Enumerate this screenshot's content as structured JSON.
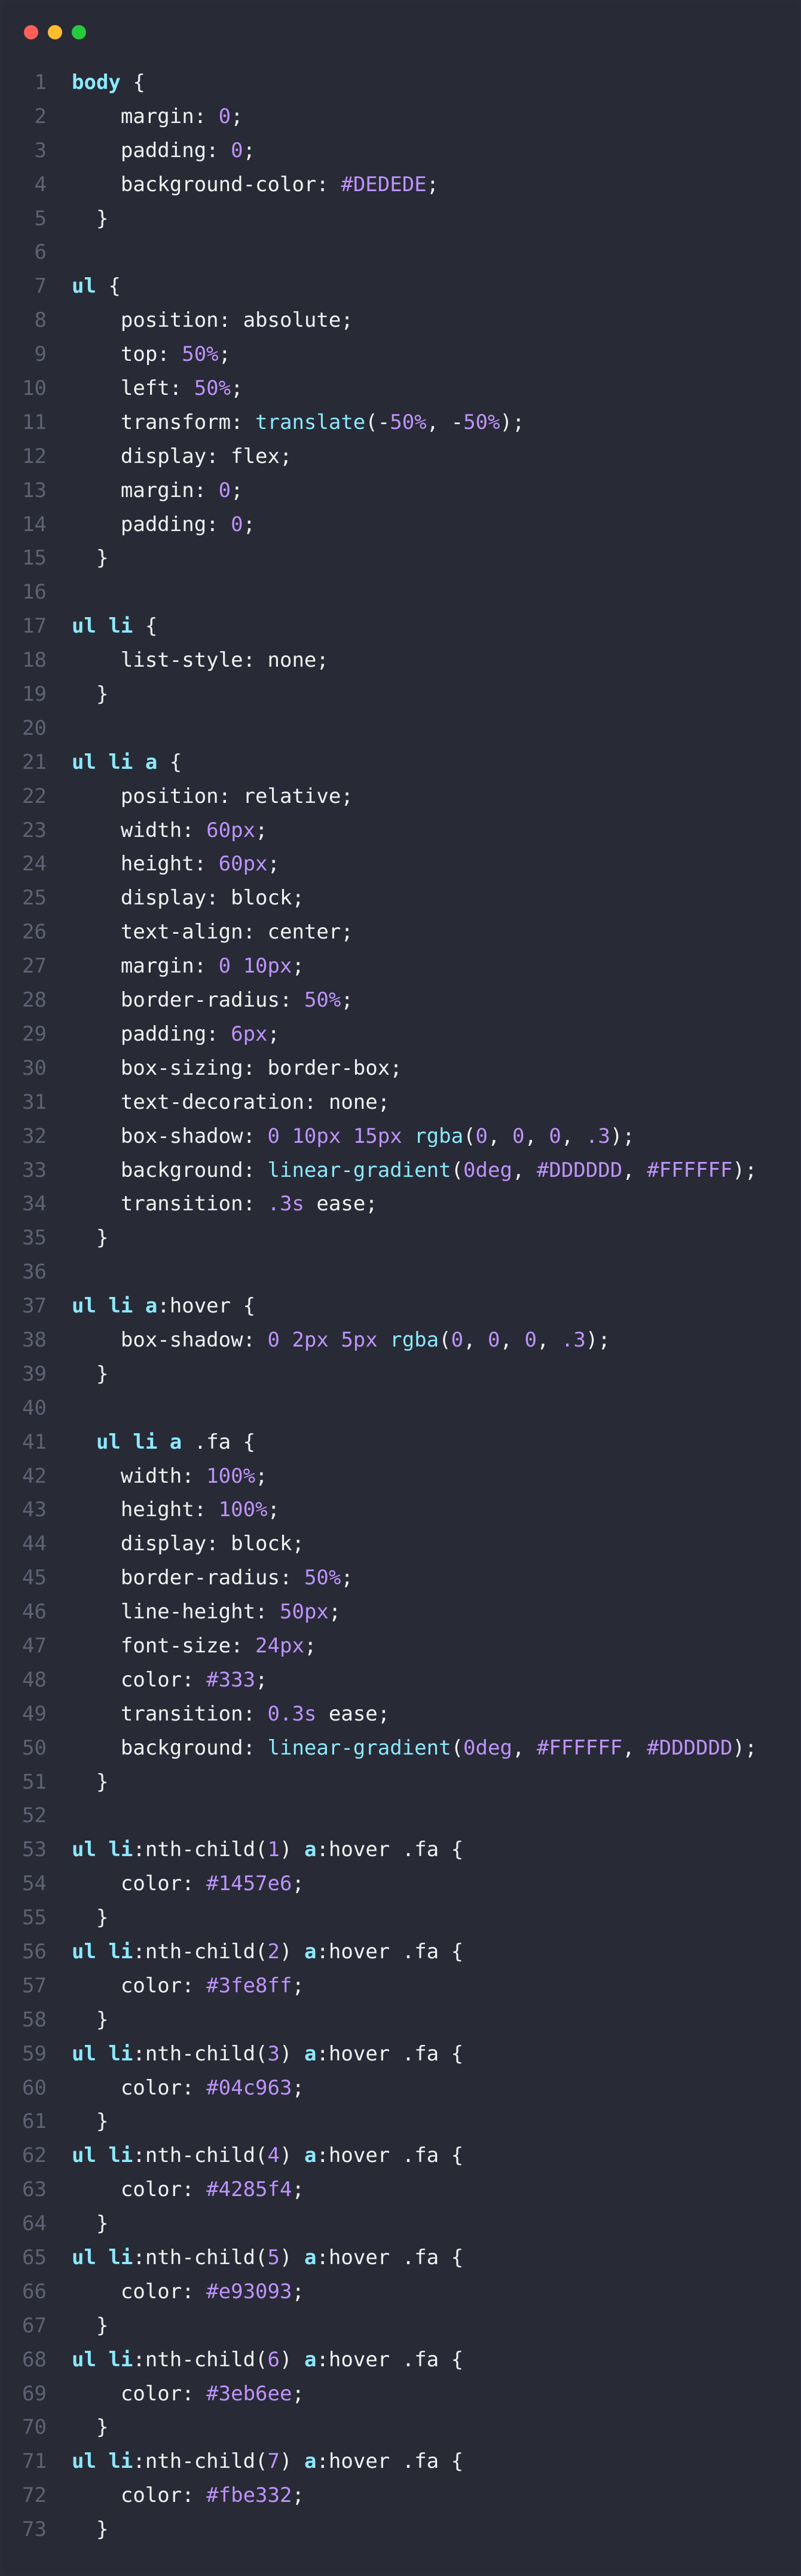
{
  "window": {
    "colors": {
      "background": "#282a36",
      "selector": "#8be9fd",
      "number": "#bd93f9",
      "text": "#f2f2f2",
      "line_number": "#5f6273"
    },
    "traffic_lights": [
      "close",
      "minimize",
      "maximize"
    ]
  },
  "code": {
    "lines": [
      [
        [
          "sel",
          "body"
        ],
        [
          "pl",
          " {"
        ]
      ],
      [
        [
          "pl",
          "    margin: "
        ],
        [
          "num",
          "0"
        ],
        [
          "pl",
          ";"
        ]
      ],
      [
        [
          "pl",
          "    padding: "
        ],
        [
          "num",
          "0"
        ],
        [
          "pl",
          ";"
        ]
      ],
      [
        [
          "pl",
          "    background-color: "
        ],
        [
          "num",
          "#DEDEDE"
        ],
        [
          "pl",
          ";"
        ]
      ],
      [
        [
          "pl",
          "  }"
        ]
      ],
      [],
      [
        [
          "sel",
          "ul"
        ],
        [
          "pl",
          " {"
        ]
      ],
      [
        [
          "pl",
          "    position: absolute;"
        ]
      ],
      [
        [
          "pl",
          "    top: "
        ],
        [
          "num",
          "50%"
        ],
        [
          "pl",
          ";"
        ]
      ],
      [
        [
          "pl",
          "    left: "
        ],
        [
          "num",
          "50%"
        ],
        [
          "pl",
          ";"
        ]
      ],
      [
        [
          "pl",
          "    transform: "
        ],
        [
          "fn",
          "translate"
        ],
        [
          "pl",
          "(-"
        ],
        [
          "num",
          "50%"
        ],
        [
          "pl",
          ", -"
        ],
        [
          "num",
          "50%"
        ],
        [
          "pl",
          ");"
        ]
      ],
      [
        [
          "pl",
          "    display: flex;"
        ]
      ],
      [
        [
          "pl",
          "    margin: "
        ],
        [
          "num",
          "0"
        ],
        [
          "pl",
          ";"
        ]
      ],
      [
        [
          "pl",
          "    padding: "
        ],
        [
          "num",
          "0"
        ],
        [
          "pl",
          ";"
        ]
      ],
      [
        [
          "pl",
          "  }"
        ]
      ],
      [],
      [
        [
          "sel",
          "ul li"
        ],
        [
          "pl",
          " {"
        ]
      ],
      [
        [
          "pl",
          "    list-style: none;"
        ]
      ],
      [
        [
          "pl",
          "  }"
        ]
      ],
      [],
      [
        [
          "sel",
          "ul li a"
        ],
        [
          "pl",
          " {"
        ]
      ],
      [
        [
          "pl",
          "    position: relative;"
        ]
      ],
      [
        [
          "pl",
          "    width: "
        ],
        [
          "num",
          "60px"
        ],
        [
          "pl",
          ";"
        ]
      ],
      [
        [
          "pl",
          "    height: "
        ],
        [
          "num",
          "60px"
        ],
        [
          "pl",
          ";"
        ]
      ],
      [
        [
          "pl",
          "    display: block;"
        ]
      ],
      [
        [
          "pl",
          "    text-align: center;"
        ]
      ],
      [
        [
          "pl",
          "    margin: "
        ],
        [
          "num",
          "0 10px"
        ],
        [
          "pl",
          ";"
        ]
      ],
      [
        [
          "pl",
          "    border-radius: "
        ],
        [
          "num",
          "50%"
        ],
        [
          "pl",
          ";"
        ]
      ],
      [
        [
          "pl",
          "    padding: "
        ],
        [
          "num",
          "6px"
        ],
        [
          "pl",
          ";"
        ]
      ],
      [
        [
          "pl",
          "    box-sizing: border-box;"
        ]
      ],
      [
        [
          "pl",
          "    text-decoration: none;"
        ]
      ],
      [
        [
          "pl",
          "    box-shadow: "
        ],
        [
          "num",
          "0 10px 15px"
        ],
        [
          "pl",
          " "
        ],
        [
          "fn",
          "rgba"
        ],
        [
          "pl",
          "("
        ],
        [
          "num",
          "0"
        ],
        [
          "pl",
          ", "
        ],
        [
          "num",
          "0"
        ],
        [
          "pl",
          ", "
        ],
        [
          "num",
          "0"
        ],
        [
          "pl",
          ", "
        ],
        [
          "num",
          ".3"
        ],
        [
          "pl",
          ");"
        ]
      ],
      [
        [
          "pl",
          "    background: "
        ],
        [
          "fn",
          "linear-gradient"
        ],
        [
          "pl",
          "("
        ],
        [
          "num",
          "0deg"
        ],
        [
          "pl",
          ", "
        ],
        [
          "num",
          "#DDDDDD"
        ],
        [
          "pl",
          ", "
        ],
        [
          "num",
          "#FFFFFF"
        ],
        [
          "pl",
          ");"
        ]
      ],
      [
        [
          "pl",
          "    transition: "
        ],
        [
          "num",
          ".3s"
        ],
        [
          "pl",
          " ease;"
        ]
      ],
      [
        [
          "pl",
          "  }"
        ]
      ],
      [],
      [
        [
          "sel",
          "ul li a"
        ],
        [
          "pl",
          ":hover {"
        ]
      ],
      [
        [
          "pl",
          "    box-shadow: "
        ],
        [
          "num",
          "0 2px 5px"
        ],
        [
          "pl",
          " "
        ],
        [
          "fn",
          "rgba"
        ],
        [
          "pl",
          "("
        ],
        [
          "num",
          "0"
        ],
        [
          "pl",
          ", "
        ],
        [
          "num",
          "0"
        ],
        [
          "pl",
          ", "
        ],
        [
          "num",
          "0"
        ],
        [
          "pl",
          ", "
        ],
        [
          "num",
          ".3"
        ],
        [
          "pl",
          ");"
        ]
      ],
      [
        [
          "pl",
          "  }"
        ]
      ],
      [],
      [
        [
          "pl",
          "  "
        ],
        [
          "sel",
          "ul li a"
        ],
        [
          "pl",
          " .fa {"
        ]
      ],
      [
        [
          "pl",
          "    width: "
        ],
        [
          "num",
          "100%"
        ],
        [
          "pl",
          ";"
        ]
      ],
      [
        [
          "pl",
          "    height: "
        ],
        [
          "num",
          "100%"
        ],
        [
          "pl",
          ";"
        ]
      ],
      [
        [
          "pl",
          "    display: block;"
        ]
      ],
      [
        [
          "pl",
          "    border-radius: "
        ],
        [
          "num",
          "50%"
        ],
        [
          "pl",
          ";"
        ]
      ],
      [
        [
          "pl",
          "    line-height: "
        ],
        [
          "num",
          "50px"
        ],
        [
          "pl",
          ";"
        ]
      ],
      [
        [
          "pl",
          "    font-size: "
        ],
        [
          "num",
          "24px"
        ],
        [
          "pl",
          ";"
        ]
      ],
      [
        [
          "pl",
          "    color: "
        ],
        [
          "num",
          "#333"
        ],
        [
          "pl",
          ";"
        ]
      ],
      [
        [
          "pl",
          "    transition: "
        ],
        [
          "num",
          "0.3s"
        ],
        [
          "pl",
          " ease;"
        ]
      ],
      [
        [
          "pl",
          "    background: "
        ],
        [
          "fn",
          "linear-gradient"
        ],
        [
          "pl",
          "("
        ],
        [
          "num",
          "0deg"
        ],
        [
          "pl",
          ", "
        ],
        [
          "num",
          "#FFFFFF"
        ],
        [
          "pl",
          ", "
        ],
        [
          "num",
          "#DDDDDD"
        ],
        [
          "pl",
          ");"
        ]
      ],
      [
        [
          "pl",
          "  }"
        ]
      ],
      [],
      [
        [
          "sel",
          "ul li"
        ],
        [
          "pl",
          ":nth-child("
        ],
        [
          "num",
          "1"
        ],
        [
          "pl",
          ") "
        ],
        [
          "sel",
          "a"
        ],
        [
          "pl",
          ":hover .fa {"
        ]
      ],
      [
        [
          "pl",
          "    color: "
        ],
        [
          "num",
          "#1457e6"
        ],
        [
          "pl",
          ";"
        ]
      ],
      [
        [
          "pl",
          "  }"
        ]
      ],
      [
        [
          "sel",
          "ul li"
        ],
        [
          "pl",
          ":nth-child("
        ],
        [
          "num",
          "2"
        ],
        [
          "pl",
          ") "
        ],
        [
          "sel",
          "a"
        ],
        [
          "pl",
          ":hover .fa {"
        ]
      ],
      [
        [
          "pl",
          "    color: "
        ],
        [
          "num",
          "#3fe8ff"
        ],
        [
          "pl",
          ";"
        ]
      ],
      [
        [
          "pl",
          "  }"
        ]
      ],
      [
        [
          "sel",
          "ul li"
        ],
        [
          "pl",
          ":nth-child("
        ],
        [
          "num",
          "3"
        ],
        [
          "pl",
          ") "
        ],
        [
          "sel",
          "a"
        ],
        [
          "pl",
          ":hover .fa {"
        ]
      ],
      [
        [
          "pl",
          "    color: "
        ],
        [
          "num",
          "#04c963"
        ],
        [
          "pl",
          ";"
        ]
      ],
      [
        [
          "pl",
          "  }"
        ]
      ],
      [
        [
          "sel",
          "ul li"
        ],
        [
          "pl",
          ":nth-child("
        ],
        [
          "num",
          "4"
        ],
        [
          "pl",
          ") "
        ],
        [
          "sel",
          "a"
        ],
        [
          "pl",
          ":hover .fa {"
        ]
      ],
      [
        [
          "pl",
          "    color: "
        ],
        [
          "num",
          "#4285f4"
        ],
        [
          "pl",
          ";"
        ]
      ],
      [
        [
          "pl",
          "  }"
        ]
      ],
      [
        [
          "sel",
          "ul li"
        ],
        [
          "pl",
          ":nth-child("
        ],
        [
          "num",
          "5"
        ],
        [
          "pl",
          ") "
        ],
        [
          "sel",
          "a"
        ],
        [
          "pl",
          ":hover .fa {"
        ]
      ],
      [
        [
          "pl",
          "    color: "
        ],
        [
          "num",
          "#e93093"
        ],
        [
          "pl",
          ";"
        ]
      ],
      [
        [
          "pl",
          "  }"
        ]
      ],
      [
        [
          "sel",
          "ul li"
        ],
        [
          "pl",
          ":nth-child("
        ],
        [
          "num",
          "6"
        ],
        [
          "pl",
          ") "
        ],
        [
          "sel",
          "a"
        ],
        [
          "pl",
          ":hover .fa {"
        ]
      ],
      [
        [
          "pl",
          "    color: "
        ],
        [
          "num",
          "#3eb6ee"
        ],
        [
          "pl",
          ";"
        ]
      ],
      [
        [
          "pl",
          "  }"
        ]
      ],
      [
        [
          "sel",
          "ul li"
        ],
        [
          "pl",
          ":nth-child("
        ],
        [
          "num",
          "7"
        ],
        [
          "pl",
          ") "
        ],
        [
          "sel",
          "a"
        ],
        [
          "pl",
          ":hover .fa {"
        ]
      ],
      [
        [
          "pl",
          "    color: "
        ],
        [
          "num",
          "#fbe332"
        ],
        [
          "pl",
          ";"
        ]
      ],
      [
        [
          "pl",
          "  }"
        ]
      ]
    ]
  }
}
